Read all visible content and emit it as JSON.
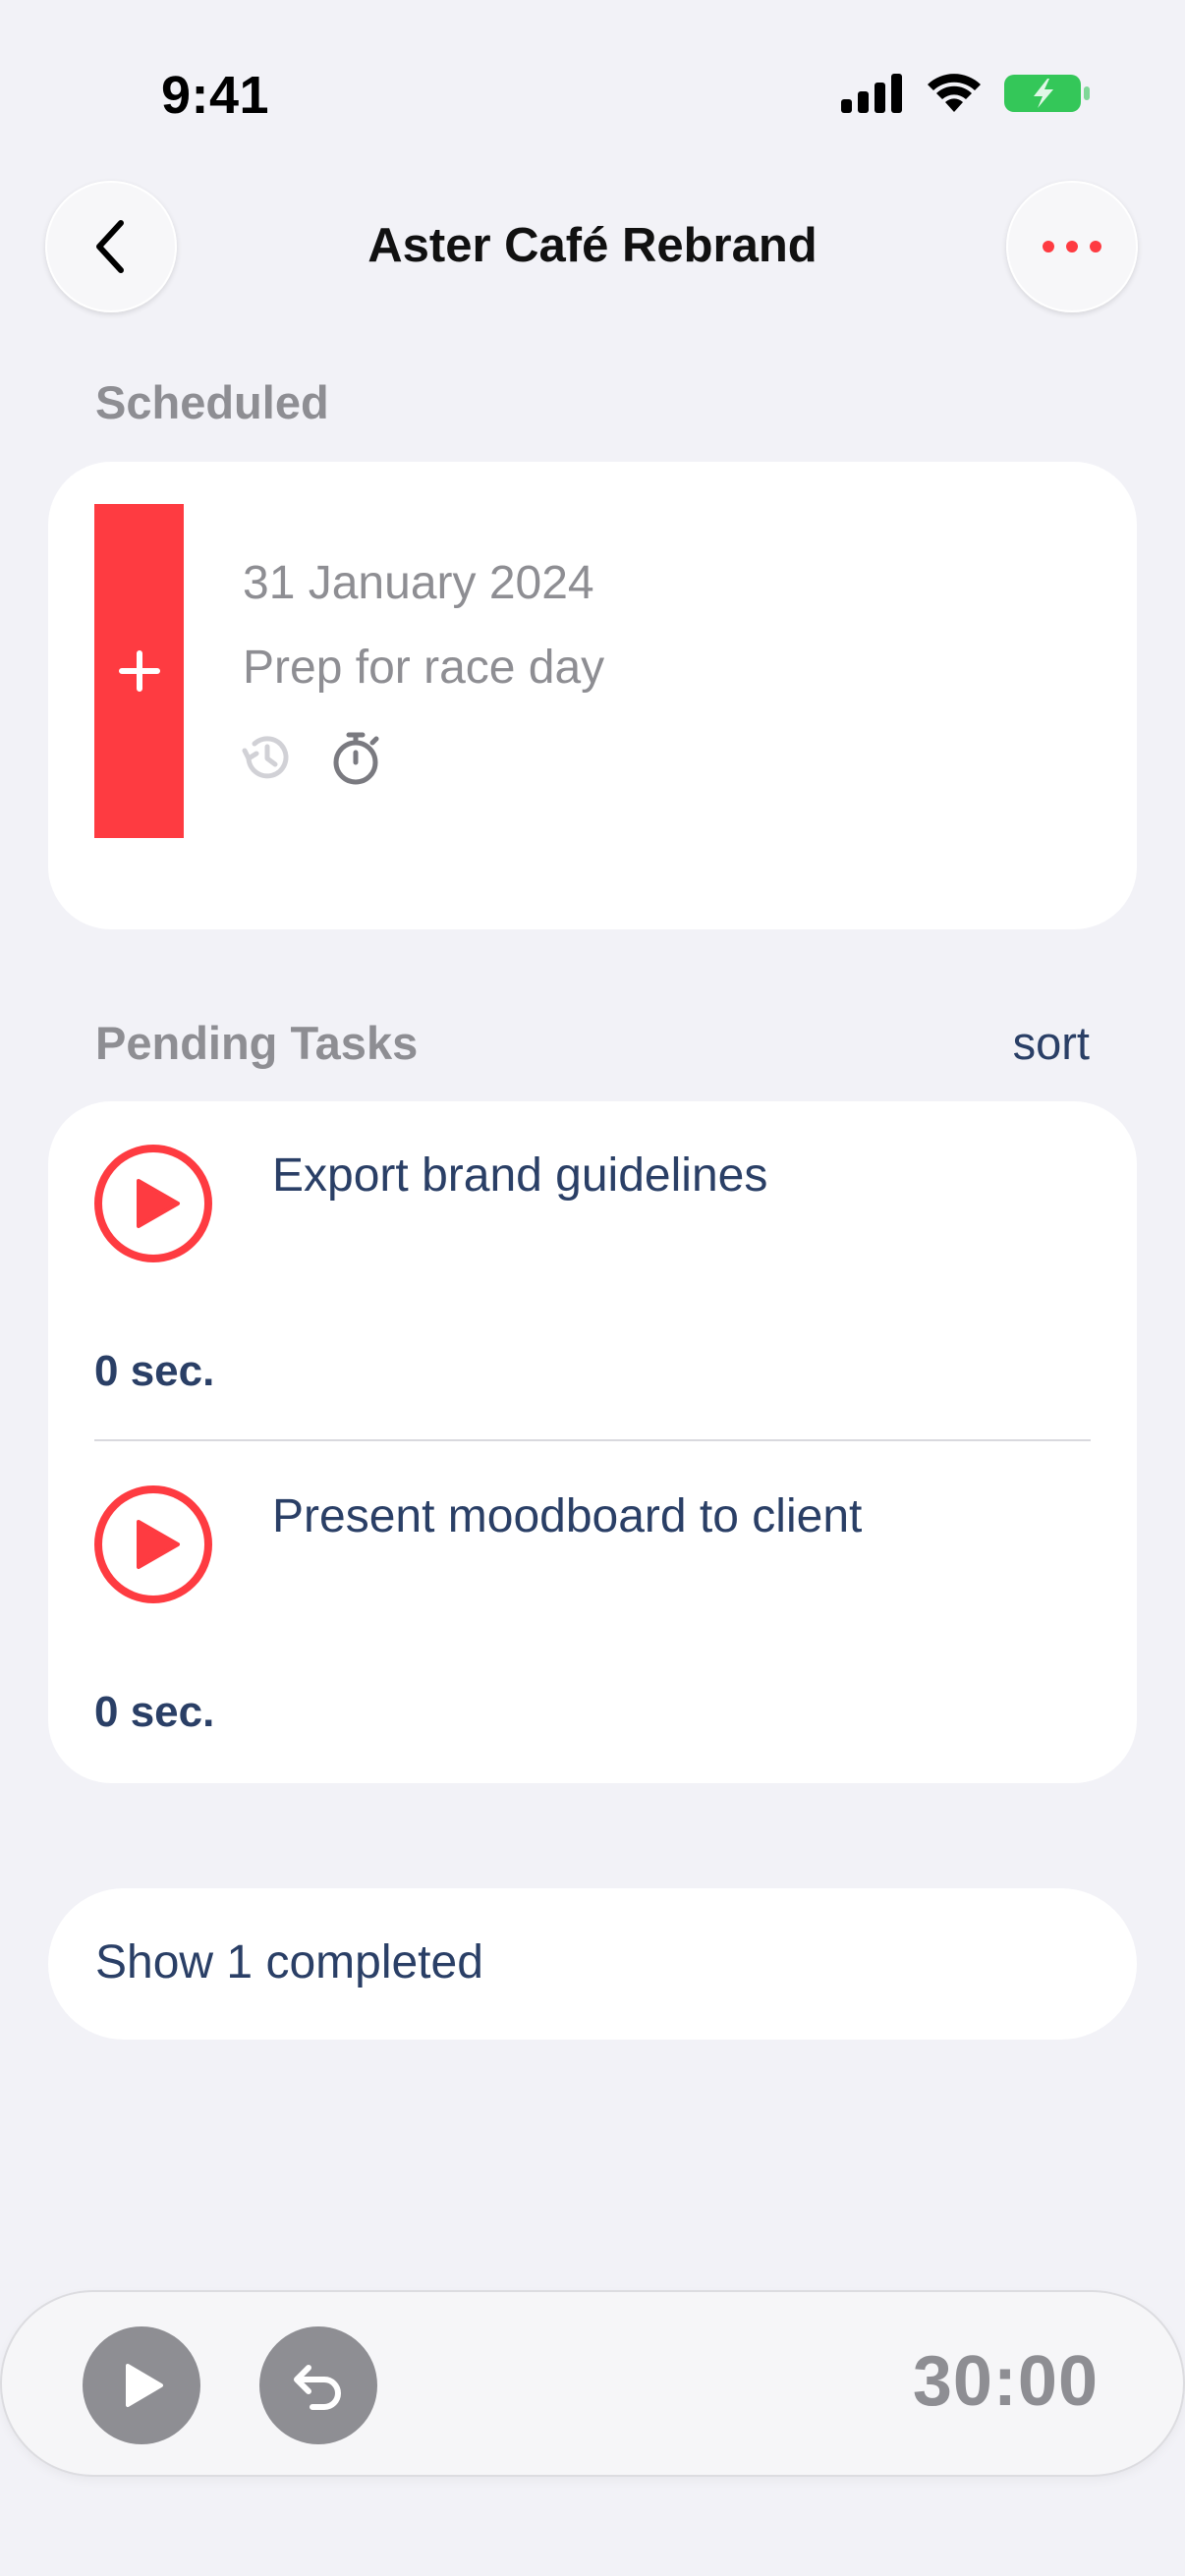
{
  "status_bar": {
    "time": "9:41"
  },
  "nav": {
    "title": "Aster Café Rebrand"
  },
  "scheduled": {
    "section_label": "Scheduled",
    "date": "31 January 2024",
    "name": "Prep for race day"
  },
  "pending": {
    "section_label": "Pending Tasks",
    "sort_label": "sort",
    "tasks": [
      {
        "name": "Export brand guidelines",
        "time": "0 sec."
      },
      {
        "name": "Present moodboard to client",
        "time": "0 sec."
      }
    ]
  },
  "completed": {
    "label": "Show 1 completed"
  },
  "timer_bar": {
    "timer": "30:00"
  },
  "colors": {
    "accent_red": "#fe3b41",
    "text_navy": "#2a3f66",
    "muted_gray": "#8e8e93",
    "background": "#f2f2f7"
  }
}
